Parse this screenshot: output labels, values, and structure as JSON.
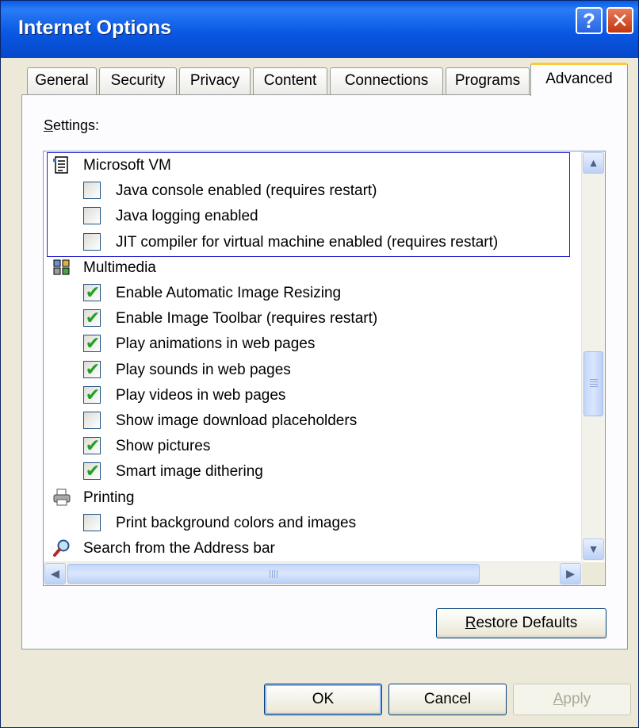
{
  "window": {
    "title": "Internet Options",
    "help_glyph": "?",
    "close_glyph": "✕"
  },
  "tabs": [
    {
      "label": "General"
    },
    {
      "label": "Security"
    },
    {
      "label": "Privacy"
    },
    {
      "label": "Content"
    },
    {
      "label": "Connections"
    },
    {
      "label": "Programs"
    },
    {
      "label": "Advanced",
      "active": true
    }
  ],
  "settings": {
    "label_first": "S",
    "label_rest": "ettings:",
    "items": [
      {
        "type": "group",
        "icon": "document-icon",
        "label": "Microsoft VM"
      },
      {
        "type": "checkbox",
        "checked": false,
        "label": "Java console enabled (requires restart)"
      },
      {
        "type": "checkbox",
        "checked": false,
        "label": "Java logging enabled"
      },
      {
        "type": "checkbox",
        "checked": false,
        "label": "JIT compiler for virtual machine enabled (requires restart)"
      },
      {
        "type": "group",
        "icon": "multimedia-icon",
        "label": "Multimedia"
      },
      {
        "type": "checkbox",
        "checked": true,
        "label": "Enable Automatic Image Resizing"
      },
      {
        "type": "checkbox",
        "checked": true,
        "label": "Enable Image Toolbar (requires restart)"
      },
      {
        "type": "checkbox",
        "checked": true,
        "label": "Play animations in web pages"
      },
      {
        "type": "checkbox",
        "checked": true,
        "label": "Play sounds in web pages"
      },
      {
        "type": "checkbox",
        "checked": true,
        "label": "Play videos in web pages"
      },
      {
        "type": "checkbox",
        "checked": false,
        "label": "Show image download placeholders"
      },
      {
        "type": "checkbox",
        "checked": true,
        "label": "Show pictures"
      },
      {
        "type": "checkbox",
        "checked": true,
        "label": "Smart image dithering"
      },
      {
        "type": "group",
        "icon": "printer-icon",
        "label": "Printing"
      },
      {
        "type": "checkbox",
        "checked": false,
        "label": "Print background colors and images"
      },
      {
        "type": "group",
        "icon": "search-icon",
        "label": "Search from the Address bar"
      }
    ]
  },
  "buttons": {
    "restore_first": "R",
    "restore_rest": "estore Defaults",
    "ok": "OK",
    "cancel": "Cancel",
    "apply_first": "A",
    "apply_rest": "pply"
  }
}
